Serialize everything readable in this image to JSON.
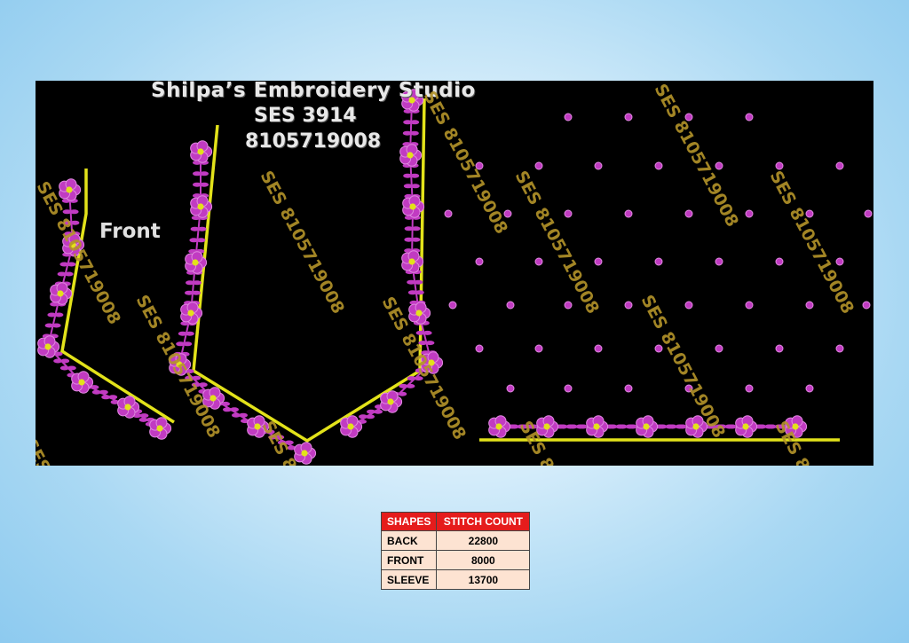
{
  "header": {
    "title": "Shilpa’s Embroidery Studio",
    "design_code": "SES 3914",
    "phone": "8105719008"
  },
  "labels": {
    "front": "Front"
  },
  "watermark": {
    "text": "SES 8105719008",
    "color": "#b4942a"
  },
  "colors": {
    "flower": "#c13bc2",
    "flower_light": "#e08ae0",
    "outline": "#e2e21a",
    "background": "#000000"
  },
  "stitch_table": {
    "headers": [
      "SHAPES",
      "STITCH COUNT"
    ],
    "rows": [
      {
        "shape": "BACK",
        "count": "22800"
      },
      {
        "shape": "FRONT",
        "count": "8000"
      },
      {
        "shape": "SLEEVE",
        "count": "13700"
      }
    ]
  }
}
